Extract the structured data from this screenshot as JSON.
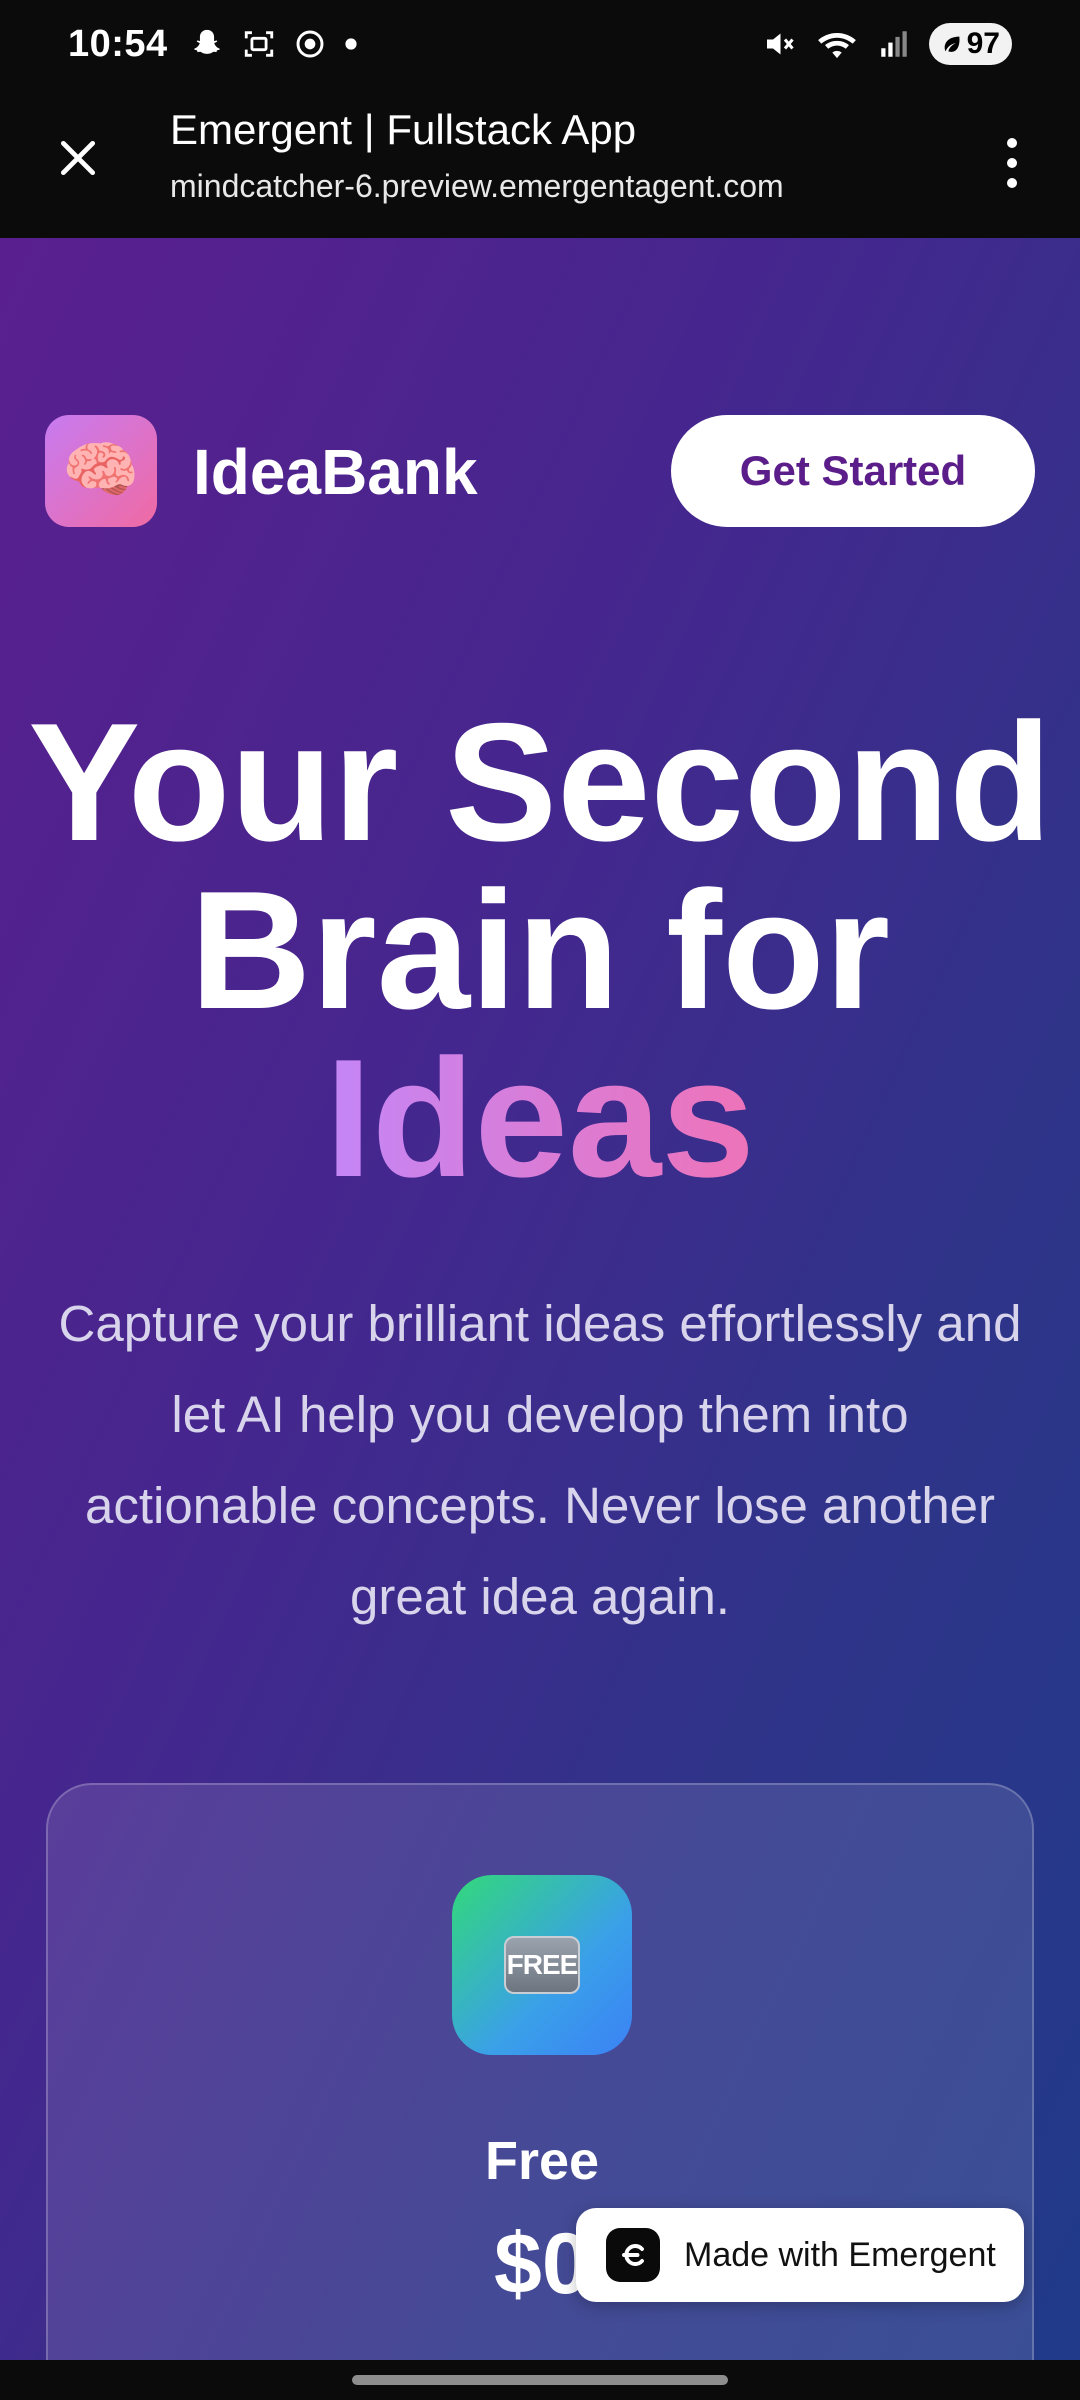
{
  "status_bar": {
    "time": "10:54",
    "battery": "97",
    "icons_left": [
      "snapchat-icon",
      "screenshot-icon",
      "record-icon",
      "dot-icon"
    ],
    "icons_right": [
      "mute-icon",
      "wifi-icon",
      "signal-icon",
      "battery-icon"
    ]
  },
  "browser": {
    "title": "Emergent | Fullstack App",
    "url": "mindcatcher-6.preview.emergentagent.com"
  },
  "header": {
    "logo_emoji": "🧠",
    "brand": "IdeaBank",
    "cta_label": "Get Started"
  },
  "hero": {
    "line1": "Your Second",
    "line2": "Brain for",
    "line3": "Ideas"
  },
  "subtitle": "Capture your brilliant ideas effortlessly and let AI help you develop them into actionable concepts. Never lose another great idea again.",
  "plan": {
    "badge": "FREE",
    "name": "Free",
    "price": "$0"
  },
  "made_with": {
    "label": "Made with Emergent"
  },
  "colors": {
    "brand_purple": "#5b1d8a",
    "gradient_start": "#5a1f8f",
    "gradient_end": "#213a8a",
    "accent_pink": "#ee73b8"
  }
}
